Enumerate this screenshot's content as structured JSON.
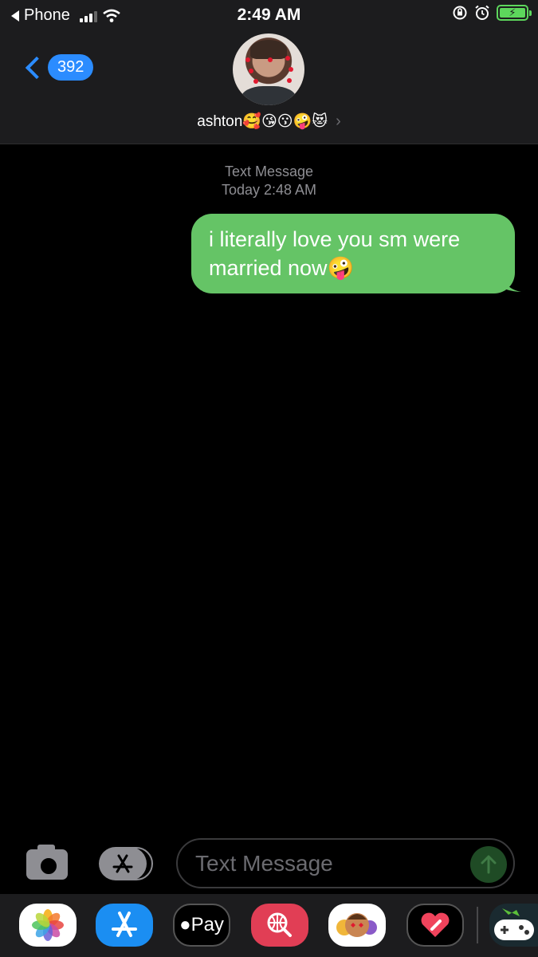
{
  "status_bar": {
    "back_app": "Phone",
    "time": "2:49 AM"
  },
  "nav": {
    "back_count": "392",
    "contact_name": "ashton🥰😘😗🤪😻"
  },
  "thread": {
    "service_label": "Text Message",
    "timestamp": "Today 2:48 AM",
    "messages": [
      {
        "direction": "sent",
        "text": "i literally love you sm were married now🤪"
      }
    ]
  },
  "compose": {
    "placeholder": "Text Message"
  },
  "app_drawer": {
    "apple_pay_label": "Pay"
  },
  "colors": {
    "sms_bubble": "#65c466",
    "accent": "#2b8cff",
    "battery": "#5dd65c"
  }
}
